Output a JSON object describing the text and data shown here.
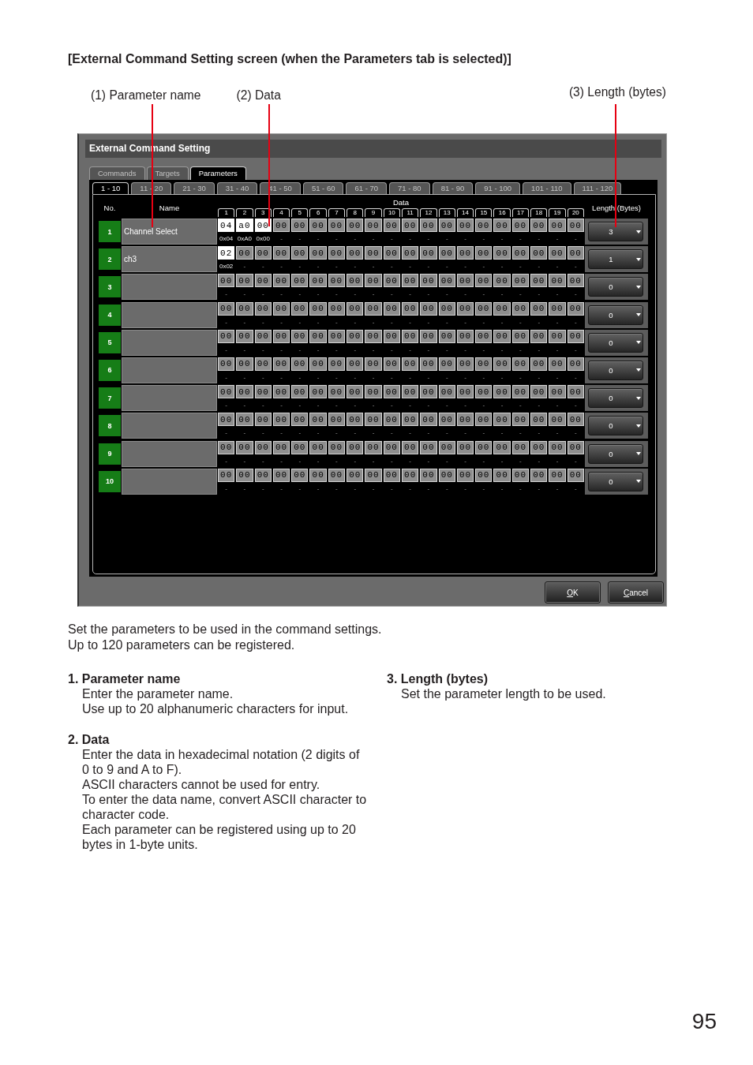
{
  "heading": "[External Command Setting screen (when the Parameters tab is selected)]",
  "callouts": [
    "(1) Parameter name",
    "(2) Data",
    "(3) Length (bytes)"
  ],
  "window": {
    "title": "External Command Setting",
    "tabs": [
      {
        "label": "Commands",
        "selected": false
      },
      {
        "label": "Targets",
        "selected": false
      },
      {
        "label": "Parameters",
        "selected": true
      }
    ],
    "page_tabs": [
      {
        "label": "1 - 10",
        "selected": true
      },
      {
        "label": "11 - 20",
        "selected": false
      },
      {
        "label": "21 - 30",
        "selected": false
      },
      {
        "label": "31 - 40",
        "selected": false
      },
      {
        "label": "41 - 50",
        "selected": false
      },
      {
        "label": "51 - 60",
        "selected": false
      },
      {
        "label": "61 - 70",
        "selected": false
      },
      {
        "label": "71 - 80",
        "selected": false
      },
      {
        "label": "81 - 90",
        "selected": false
      },
      {
        "label": "91 - 100",
        "selected": false
      },
      {
        "label": "101 - 110",
        "selected": false
      },
      {
        "label": "111 - 120",
        "selected": false
      }
    ],
    "table": {
      "columns": {
        "number": "No.",
        "name": "Name",
        "data": "Data",
        "length": "Length (Bytes)"
      },
      "byte_columns": [
        "1",
        "2",
        "3",
        "4",
        "5",
        "6",
        "7",
        "8",
        "9",
        "10",
        "11",
        "12",
        "13",
        "14",
        "15",
        "16",
        "17",
        "18",
        "19",
        "20"
      ],
      "rows": [
        {
          "number": "1",
          "name": "Channel Select",
          "length": "3",
          "bytes": [
            {
              "value": "04",
              "hex": "0x04",
              "active": true
            },
            {
              "value": "a0",
              "hex": "0xA0",
              "active": true
            },
            {
              "value": "00",
              "hex": "0x00",
              "active": true
            },
            {
              "value": "00",
              "hex": "-",
              "active": false
            },
            {
              "value": "00",
              "hex": "-",
              "active": false
            },
            {
              "value": "00",
              "hex": "-",
              "active": false
            },
            {
              "value": "00",
              "hex": "-",
              "active": false
            },
            {
              "value": "00",
              "hex": "-",
              "active": false
            },
            {
              "value": "00",
              "hex": "-",
              "active": false
            },
            {
              "value": "00",
              "hex": "-",
              "active": false
            },
            {
              "value": "00",
              "hex": "-",
              "active": false
            },
            {
              "value": "00",
              "hex": "-",
              "active": false
            },
            {
              "value": "00",
              "hex": "-",
              "active": false
            },
            {
              "value": "00",
              "hex": "-",
              "active": false
            },
            {
              "value": "00",
              "hex": "-",
              "active": false
            },
            {
              "value": "00",
              "hex": "-",
              "active": false
            },
            {
              "value": "00",
              "hex": "-",
              "active": false
            },
            {
              "value": "00",
              "hex": "-",
              "active": false
            },
            {
              "value": "00",
              "hex": "-",
              "active": false
            },
            {
              "value": "00",
              "hex": "-",
              "active": false
            }
          ]
        },
        {
          "number": "2",
          "name": "ch3",
          "length": "1",
          "bytes": [
            {
              "value": "02",
              "hex": "0x02",
              "active": true
            },
            {
              "value": "00",
              "hex": "-",
              "active": false
            },
            {
              "value": "00",
              "hex": "-",
              "active": false
            },
            {
              "value": "00",
              "hex": "-",
              "active": false
            },
            {
              "value": "00",
              "hex": "-",
              "active": false
            },
            {
              "value": "00",
              "hex": "-",
              "active": false
            },
            {
              "value": "00",
              "hex": "-",
              "active": false
            },
            {
              "value": "00",
              "hex": "-",
              "active": false
            },
            {
              "value": "00",
              "hex": "-",
              "active": false
            },
            {
              "value": "00",
              "hex": "-",
              "active": false
            },
            {
              "value": "00",
              "hex": "-",
              "active": false
            },
            {
              "value": "00",
              "hex": "-",
              "active": false
            },
            {
              "value": "00",
              "hex": "-",
              "active": false
            },
            {
              "value": "00",
              "hex": "-",
              "active": false
            },
            {
              "value": "00",
              "hex": "-",
              "active": false
            },
            {
              "value": "00",
              "hex": "-",
              "active": false
            },
            {
              "value": "00",
              "hex": "-",
              "active": false
            },
            {
              "value": "00",
              "hex": "-",
              "active": false
            },
            {
              "value": "00",
              "hex": "-",
              "active": false
            },
            {
              "value": "00",
              "hex": "-",
              "active": false
            }
          ]
        },
        {
          "number": "3",
          "length": "0",
          "bytes": [
            {
              "value": "00",
              "hex": "-",
              "active": false
            },
            {
              "value": "00",
              "hex": "-",
              "active": false
            },
            {
              "value": "00",
              "hex": "-",
              "active": false
            },
            {
              "value": "00",
              "hex": "-",
              "active": false
            },
            {
              "value": "00",
              "hex": "-",
              "active": false
            },
            {
              "value": "00",
              "hex": "-",
              "active": false
            },
            {
              "value": "00",
              "hex": "-",
              "active": false
            },
            {
              "value": "00",
              "hex": "-",
              "active": false
            },
            {
              "value": "00",
              "hex": "-",
              "active": false
            },
            {
              "value": "00",
              "hex": "-",
              "active": false
            },
            {
              "value": "00",
              "hex": "-",
              "active": false
            },
            {
              "value": "00",
              "hex": "-",
              "active": false
            },
            {
              "value": "00",
              "hex": "-",
              "active": false
            },
            {
              "value": "00",
              "hex": "-",
              "active": false
            },
            {
              "value": "00",
              "hex": "-",
              "active": false
            },
            {
              "value": "00",
              "hex": "-",
              "active": false
            },
            {
              "value": "00",
              "hex": "-",
              "active": false
            },
            {
              "value": "00",
              "hex": "-",
              "active": false
            },
            {
              "value": "00",
              "hex": "-",
              "active": false
            },
            {
              "value": "00",
              "hex": "-",
              "active": false
            }
          ]
        },
        {
          "number": "4",
          "length": "0",
          "bytes": [
            {
              "value": "00",
              "hex": "-",
              "active": false
            },
            {
              "value": "00",
              "hex": "-",
              "active": false
            },
            {
              "value": "00",
              "hex": "-",
              "active": false
            },
            {
              "value": "00",
              "hex": "-",
              "active": false
            },
            {
              "value": "00",
              "hex": "-",
              "active": false
            },
            {
              "value": "00",
              "hex": "-",
              "active": false
            },
            {
              "value": "00",
              "hex": "-",
              "active": false
            },
            {
              "value": "00",
              "hex": "-",
              "active": false
            },
            {
              "value": "00",
              "hex": "-",
              "active": false
            },
            {
              "value": "00",
              "hex": "-",
              "active": false
            },
            {
              "value": "00",
              "hex": "-",
              "active": false
            },
            {
              "value": "00",
              "hex": "-",
              "active": false
            },
            {
              "value": "00",
              "hex": "-",
              "active": false
            },
            {
              "value": "00",
              "hex": "-",
              "active": false
            },
            {
              "value": "00",
              "hex": "-",
              "active": false
            },
            {
              "value": "00",
              "hex": "-",
              "active": false
            },
            {
              "value": "00",
              "hex": "-",
              "active": false
            },
            {
              "value": "00",
              "hex": "-",
              "active": false
            },
            {
              "value": "00",
              "hex": "-",
              "active": false
            },
            {
              "value": "00",
              "hex": "-",
              "active": false
            }
          ]
        },
        {
          "number": "5",
          "length": "0",
          "bytes": [
            {
              "value": "00",
              "hex": "-",
              "active": false
            },
            {
              "value": "00",
              "hex": "-",
              "active": false
            },
            {
              "value": "00",
              "hex": "-",
              "active": false
            },
            {
              "value": "00",
              "hex": "-",
              "active": false
            },
            {
              "value": "00",
              "hex": "-",
              "active": false
            },
            {
              "value": "00",
              "hex": "-",
              "active": false
            },
            {
              "value": "00",
              "hex": "-",
              "active": false
            },
            {
              "value": "00",
              "hex": "-",
              "active": false
            },
            {
              "value": "00",
              "hex": "-",
              "active": false
            },
            {
              "value": "00",
              "hex": "-",
              "active": false
            },
            {
              "value": "00",
              "hex": "-",
              "active": false
            },
            {
              "value": "00",
              "hex": "-",
              "active": false
            },
            {
              "value": "00",
              "hex": "-",
              "active": false
            },
            {
              "value": "00",
              "hex": "-",
              "active": false
            },
            {
              "value": "00",
              "hex": "-",
              "active": false
            },
            {
              "value": "00",
              "hex": "-",
              "active": false
            },
            {
              "value": "00",
              "hex": "-",
              "active": false
            },
            {
              "value": "00",
              "hex": "-",
              "active": false
            },
            {
              "value": "00",
              "hex": "-",
              "active": false
            },
            {
              "value": "00",
              "hex": "-",
              "active": false
            }
          ]
        },
        {
          "number": "6",
          "length": "0",
          "bytes": [
            {
              "value": "00",
              "hex": "-",
              "active": false
            },
            {
              "value": "00",
              "hex": "-",
              "active": false
            },
            {
              "value": "00",
              "hex": "-",
              "active": false
            },
            {
              "value": "00",
              "hex": "-",
              "active": false
            },
            {
              "value": "00",
              "hex": "-",
              "active": false
            },
            {
              "value": "00",
              "hex": "-",
              "active": false
            },
            {
              "value": "00",
              "hex": "-",
              "active": false
            },
            {
              "value": "00",
              "hex": "-",
              "active": false
            },
            {
              "value": "00",
              "hex": "-",
              "active": false
            },
            {
              "value": "00",
              "hex": "-",
              "active": false
            },
            {
              "value": "00",
              "hex": "-",
              "active": false
            },
            {
              "value": "00",
              "hex": "-",
              "active": false
            },
            {
              "value": "00",
              "hex": "-",
              "active": false
            },
            {
              "value": "00",
              "hex": "-",
              "active": false
            },
            {
              "value": "00",
              "hex": "-",
              "active": false
            },
            {
              "value": "00",
              "hex": "-",
              "active": false
            },
            {
              "value": "00",
              "hex": "-",
              "active": false
            },
            {
              "value": "00",
              "hex": "-",
              "active": false
            },
            {
              "value": "00",
              "hex": "-",
              "active": false
            },
            {
              "value": "00",
              "hex": "-",
              "active": false
            }
          ]
        },
        {
          "number": "7",
          "length": "0",
          "bytes": [
            {
              "value": "00",
              "hex": "-",
              "active": false
            },
            {
              "value": "00",
              "hex": "-",
              "active": false
            },
            {
              "value": "00",
              "hex": "-",
              "active": false
            },
            {
              "value": "00",
              "hex": "-",
              "active": false
            },
            {
              "value": "00",
              "hex": "-",
              "active": false
            },
            {
              "value": "00",
              "hex": "-",
              "active": false
            },
            {
              "value": "00",
              "hex": "-",
              "active": false
            },
            {
              "value": "00",
              "hex": "-",
              "active": false
            },
            {
              "value": "00",
              "hex": "-",
              "active": false
            },
            {
              "value": "00",
              "hex": "-",
              "active": false
            },
            {
              "value": "00",
              "hex": "-",
              "active": false
            },
            {
              "value": "00",
              "hex": "-",
              "active": false
            },
            {
              "value": "00",
              "hex": "-",
              "active": false
            },
            {
              "value": "00",
              "hex": "-",
              "active": false
            },
            {
              "value": "00",
              "hex": "-",
              "active": false
            },
            {
              "value": "00",
              "hex": "-",
              "active": false
            },
            {
              "value": "00",
              "hex": "-",
              "active": false
            },
            {
              "value": "00",
              "hex": "-",
              "active": false
            },
            {
              "value": "00",
              "hex": "-",
              "active": false
            },
            {
              "value": "00",
              "hex": "-",
              "active": false
            }
          ]
        },
        {
          "number": "8",
          "length": "0",
          "bytes": [
            {
              "value": "00",
              "hex": "-",
              "active": false
            },
            {
              "value": "00",
              "hex": "-",
              "active": false
            },
            {
              "value": "00",
              "hex": "-",
              "active": false
            },
            {
              "value": "00",
              "hex": "-",
              "active": false
            },
            {
              "value": "00",
              "hex": "-",
              "active": false
            },
            {
              "value": "00",
              "hex": "-",
              "active": false
            },
            {
              "value": "00",
              "hex": "-",
              "active": false
            },
            {
              "value": "00",
              "hex": "-",
              "active": false
            },
            {
              "value": "00",
              "hex": "-",
              "active": false
            },
            {
              "value": "00",
              "hex": "-",
              "active": false
            },
            {
              "value": "00",
              "hex": "-",
              "active": false
            },
            {
              "value": "00",
              "hex": "-",
              "active": false
            },
            {
              "value": "00",
              "hex": "-",
              "active": false
            },
            {
              "value": "00",
              "hex": "-",
              "active": false
            },
            {
              "value": "00",
              "hex": "-",
              "active": false
            },
            {
              "value": "00",
              "hex": "-",
              "active": false
            },
            {
              "value": "00",
              "hex": "-",
              "active": false
            },
            {
              "value": "00",
              "hex": "-",
              "active": false
            },
            {
              "value": "00",
              "hex": "-",
              "active": false
            },
            {
              "value": "00",
              "hex": "-",
              "active": false
            }
          ]
        },
        {
          "number": "9",
          "length": "0",
          "bytes": [
            {
              "value": "00",
              "hex": "-",
              "active": false
            },
            {
              "value": "00",
              "hex": "-",
              "active": false
            },
            {
              "value": "00",
              "hex": "-",
              "active": false
            },
            {
              "value": "00",
              "hex": "-",
              "active": false
            },
            {
              "value": "00",
              "hex": "-",
              "active": false
            },
            {
              "value": "00",
              "hex": "-",
              "active": false
            },
            {
              "value": "00",
              "hex": "-",
              "active": false
            },
            {
              "value": "00",
              "hex": "-",
              "active": false
            },
            {
              "value": "00",
              "hex": "-",
              "active": false
            },
            {
              "value": "00",
              "hex": "-",
              "active": false
            },
            {
              "value": "00",
              "hex": "-",
              "active": false
            },
            {
              "value": "00",
              "hex": "-",
              "active": false
            },
            {
              "value": "00",
              "hex": "-",
              "active": false
            },
            {
              "value": "00",
              "hex": "-",
              "active": false
            },
            {
              "value": "00",
              "hex": "-",
              "active": false
            },
            {
              "value": "00",
              "hex": "-",
              "active": false
            },
            {
              "value": "00",
              "hex": "-",
              "active": false
            },
            {
              "value": "00",
              "hex": "-",
              "active": false
            },
            {
              "value": "00",
              "hex": "-",
              "active": false
            },
            {
              "value": "00",
              "hex": "-",
              "active": false
            }
          ]
        },
        {
          "number": "10",
          "length": "0",
          "bytes": [
            {
              "value": "00",
              "hex": "-",
              "active": false
            },
            {
              "value": "00",
              "hex": "-",
              "active": false
            },
            {
              "value": "00",
              "hex": "-",
              "active": false
            },
            {
              "value": "00",
              "hex": "-",
              "active": false
            },
            {
              "value": "00",
              "hex": "-",
              "active": false
            },
            {
              "value": "00",
              "hex": "-",
              "active": false
            },
            {
              "value": "00",
              "hex": "-",
              "active": false
            },
            {
              "value": "00",
              "hex": "-",
              "active": false
            },
            {
              "value": "00",
              "hex": "-",
              "active": false
            },
            {
              "value": "00",
              "hex": "-",
              "active": false
            },
            {
              "value": "00",
              "hex": "-",
              "active": false
            },
            {
              "value": "00",
              "hex": "-",
              "active": false
            },
            {
              "value": "00",
              "hex": "-",
              "active": false
            },
            {
              "value": "00",
              "hex": "-",
              "active": false
            },
            {
              "value": "00",
              "hex": "-",
              "active": false
            },
            {
              "value": "00",
              "hex": "-",
              "active": false
            },
            {
              "value": "00",
              "hex": "-",
              "active": false
            },
            {
              "value": "00",
              "hex": "-",
              "active": false
            },
            {
              "value": "00",
              "hex": "-",
              "active": false
            },
            {
              "value": "00",
              "hex": "-",
              "active": false
            }
          ]
        }
      ]
    },
    "buttons": [
      "OK",
      "Cancel"
    ]
  },
  "description": [
    "Set the parameters to be used in the command settings.",
    "Up to 120 parameters can be registered."
  ],
  "notes": [
    [
      {
        "title": "1. Parameter name",
        "paragraphs": [
          "Enter the parameter name.",
          "Use up to 20 alphanumeric characters for input."
        ]
      },
      {
        "title": "2. Data",
        "paragraphs": [
          "Enter the data in hexadecimal notation (2 digits of 0 to 9 and A to F).",
          "ASCII characters cannot be used for entry.",
          "To enter the data name, convert ASCII character to character code.",
          "Each parameter can be registered using up to 20 bytes in 1-byte units."
        ]
      }
    ],
    [
      {
        "title": "3. Length (bytes)",
        "paragraphs": [
          "Set the parameter length to be used."
        ]
      }
    ]
  ],
  "page_number": "95"
}
